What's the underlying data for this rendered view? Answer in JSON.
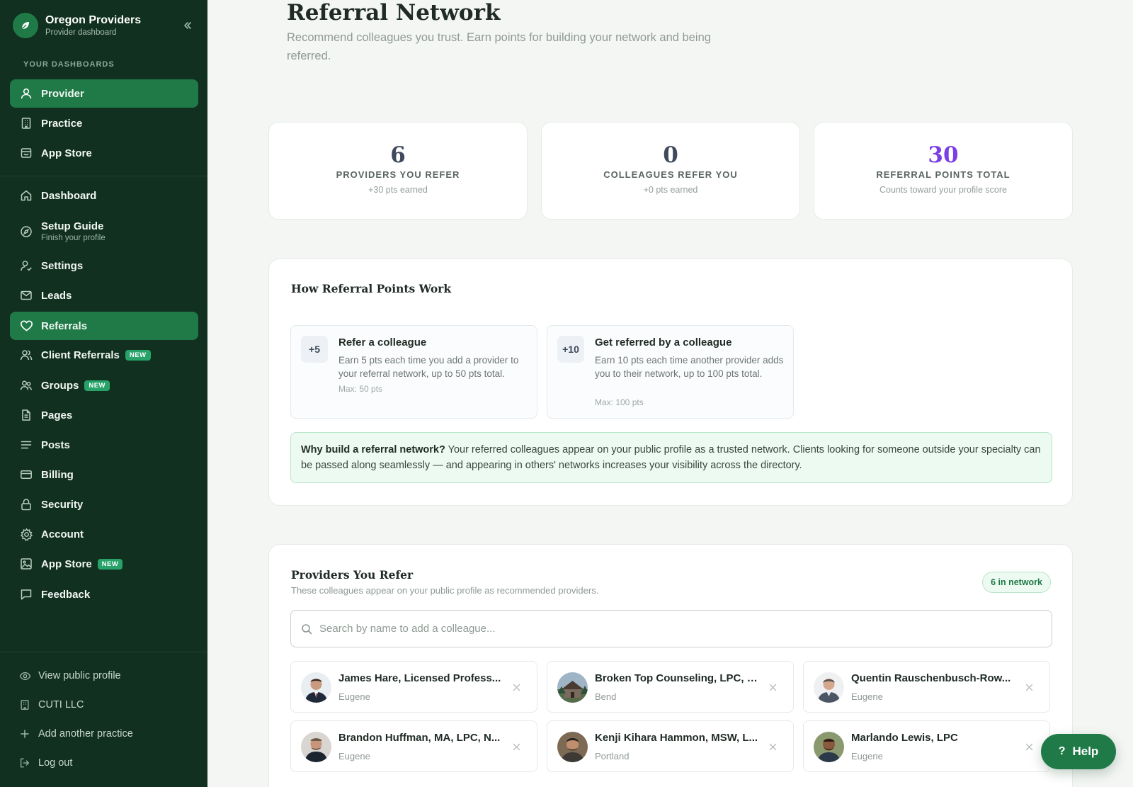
{
  "brand": {
    "title": "Oregon Providers",
    "subtitle": "Provider dashboard"
  },
  "sidebar": {
    "section_label": "YOUR DASHBOARDS",
    "top_items": [
      {
        "label": "Provider",
        "icon": "user-icon",
        "active": true
      },
      {
        "label": "Practice",
        "icon": "building-icon"
      },
      {
        "label": "App Store",
        "icon": "store-icon"
      }
    ],
    "items": [
      {
        "label": "Dashboard",
        "icon": "home-icon"
      },
      {
        "label": "Setup Guide",
        "sub": "Finish your profile",
        "icon": "compass-icon"
      },
      {
        "label": "Settings",
        "icon": "user-settings-icon"
      },
      {
        "label": "Leads",
        "icon": "mail-icon"
      },
      {
        "label": "Referrals",
        "icon": "heart-icon",
        "active": true
      },
      {
        "label": "Client Referrals",
        "badge": "NEW",
        "icon": "users-icon"
      },
      {
        "label": "Groups",
        "badge": "NEW",
        "icon": "group-icon"
      },
      {
        "label": "Pages",
        "icon": "file-icon"
      },
      {
        "label": "Posts",
        "icon": "lines-icon"
      },
      {
        "label": "Billing",
        "icon": "credit-card-icon"
      },
      {
        "label": "Security",
        "icon": "lock-icon"
      },
      {
        "label": "Account",
        "icon": "gear-icon"
      },
      {
        "label": "App Store",
        "badge": "NEW",
        "icon": "image-icon"
      },
      {
        "label": "Feedback",
        "icon": "message-icon"
      }
    ],
    "footer": [
      {
        "label": "View public profile",
        "icon": "eye-icon"
      },
      {
        "label": "CUTI LLC",
        "icon": "building-icon"
      },
      {
        "label": "Add another practice",
        "icon": "plus-icon"
      },
      {
        "label": "Log out",
        "icon": "logout-icon"
      }
    ]
  },
  "header": {
    "title": "Referral Network",
    "subtitle": "Recommend colleagues you trust. Earn points for building your network and being referred."
  },
  "stats": [
    {
      "value": "6",
      "label": "PROVIDERS YOU REFER",
      "note": "+30 pts earned"
    },
    {
      "value": "0",
      "label": "COLLEAGUES REFER YOU",
      "note": "+0 pts earned"
    },
    {
      "value": "30",
      "label": "REFERRAL POINTS TOTAL",
      "note": "Counts toward your profile score",
      "color": "#7b3fe4"
    }
  ],
  "how": {
    "title": "How Referral Points Work",
    "items": [
      {
        "pill": "+5",
        "title": "Refer a colleague",
        "desc": "Earn 5 pts each time you add a provider to your referral network, up to 50 pts total.",
        "max": "Max: 50 pts"
      },
      {
        "pill": "+10",
        "title": "Get referred by a colleague",
        "desc": "Earn 10 pts each time another provider adds you to their network, up to 100 pts total.",
        "max": "Max: 100 pts"
      }
    ],
    "why_bold": "Why build a referral network?",
    "why_text": " Your referred colleagues appear on your public profile as a trusted network. Clients looking for someone outside your specialty can be passed along seamlessly — and appearing in others' networks increases your visibility across the directory."
  },
  "refer": {
    "title": "Providers You Refer",
    "subtitle": "These colleagues appear on your public profile as recommended providers.",
    "badge": "6 in network",
    "search_placeholder": "Search by name to add a colleague...",
    "providers": [
      {
        "name": "James Hare, Licensed Profess...",
        "city": "Eugene"
      },
      {
        "name": "Broken Top Counseling, LPC, L...",
        "city": "Bend"
      },
      {
        "name": "Quentin Rauschenbusch-Row...",
        "city": "Eugene"
      },
      {
        "name": "Brandon Huffman, MA, LPC, N...",
        "city": "Eugene"
      },
      {
        "name": "Kenji Kihara Hammon, MSW, L...",
        "city": "Portland"
      },
      {
        "name": "Marlando Lewis, LPC",
        "city": "Eugene"
      }
    ]
  },
  "help": {
    "icon": "?",
    "label": "Help"
  },
  "colors": {
    "sidebar": "#11301f",
    "accent": "#1f7a47",
    "purple": "#7b3fe4"
  }
}
